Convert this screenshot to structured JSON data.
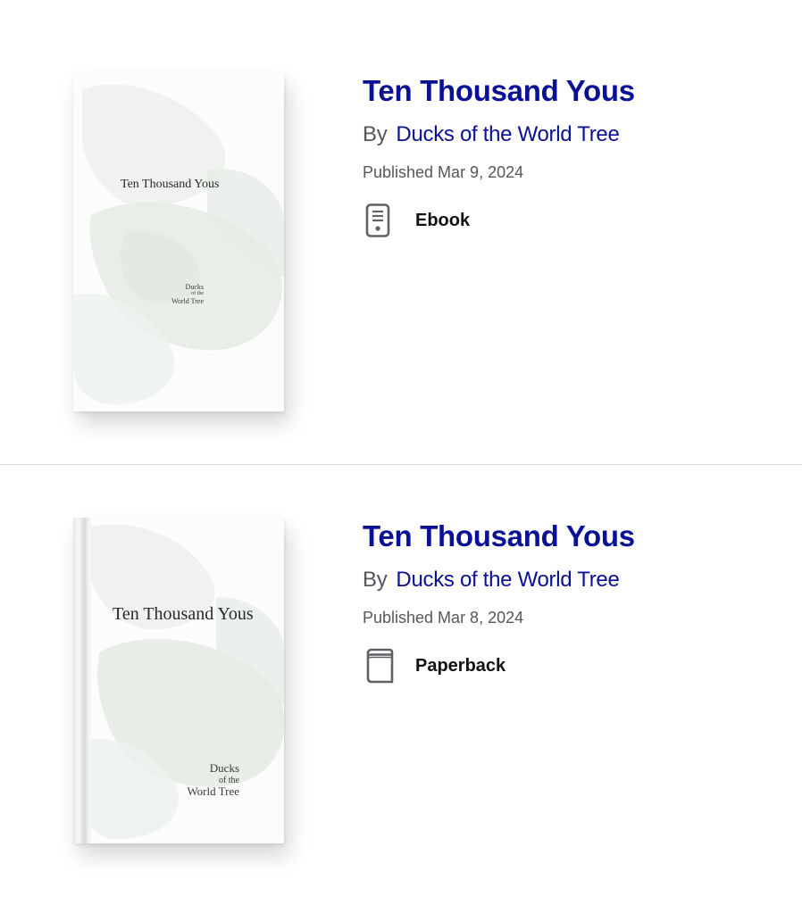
{
  "books": [
    {
      "title": "Ten Thousand Yous",
      "by_label": "By",
      "author": "Ducks of the World Tree",
      "published": "Published Mar 9, 2024",
      "format": {
        "label": "Ebook",
        "icon": "ebook-icon"
      },
      "cover": {
        "title": "Ten Thousand Yous",
        "author_line1": "Ducks",
        "author_line2": "of the",
        "author_line3": "World Tree"
      }
    },
    {
      "title": "Ten Thousand Yous",
      "by_label": "By",
      "author": "Ducks of the World Tree",
      "published": "Published Mar 8, 2024",
      "format": {
        "label": "Paperback",
        "icon": "paperback-icon"
      },
      "cover": {
        "title": "Ten Thousand Yous",
        "author_line1": "Ducks",
        "author_line2": "of the",
        "author_line3": "World Tree"
      }
    }
  ],
  "colors": {
    "accent": "#0a1196",
    "muted_text": "#55575d",
    "divider": "#d9dbe3"
  }
}
